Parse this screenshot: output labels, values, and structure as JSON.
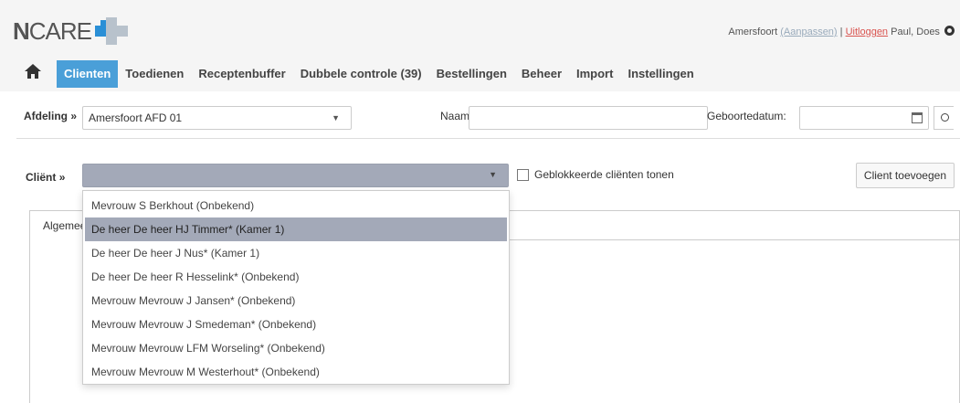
{
  "header": {
    "logo_text_bold": "N",
    "logo_text": "CARE",
    "location": "Amersfoort",
    "change_link": "(Aanpassen)",
    "separator": "|",
    "logout_link": "Uitloggen",
    "user_name": "Paul, Does"
  },
  "nav": {
    "items": [
      {
        "label": "Clienten",
        "active": true
      },
      {
        "label": "Toedienen"
      },
      {
        "label": "Receptenbuffer"
      },
      {
        "label": "Dubbele controle (39)"
      },
      {
        "label": "Bestellingen"
      },
      {
        "label": "Beheer"
      },
      {
        "label": "Import"
      },
      {
        "label": "Instellingen"
      }
    ]
  },
  "filter": {
    "department_label": "Afdeling",
    "department_sep": "»",
    "department_value": "Amersfoort AFD 01",
    "name_label": "Naam:",
    "name_value": "",
    "dob_label": "Geboortedatum:",
    "dob_value": ""
  },
  "client": {
    "label": "Cliënt",
    "sep": "»",
    "selected_value": "",
    "show_blocked_label": "Geblokkeerde cliënten tonen",
    "show_blocked_checked": false,
    "add_button": "Client toevoegen",
    "tab_label": "Algemeen",
    "options": [
      "Mevrouw S Berkhout (Onbekend)",
      "De heer De heer HJ Timmer* (Kamer 1)",
      "De heer De heer J Nus* (Kamer 1)",
      "De heer De heer R Hesselink* (Onbekend)",
      "Mevrouw Mevrouw J Jansen* (Onbekend)",
      "Mevrouw Mevrouw J Smedeman* (Onbekend)",
      "Mevrouw Mevrouw LFM Worseling* (Onbekend)",
      "Mevrouw Mevrouw M Westerhout* (Onbekend)"
    ],
    "highlighted_index": 1
  },
  "colors": {
    "accent": "#4a9fd8",
    "highlight": "#a3a9b8",
    "logo_blue": "#2a8fd6",
    "logo_grey": "#b8c2cc"
  }
}
